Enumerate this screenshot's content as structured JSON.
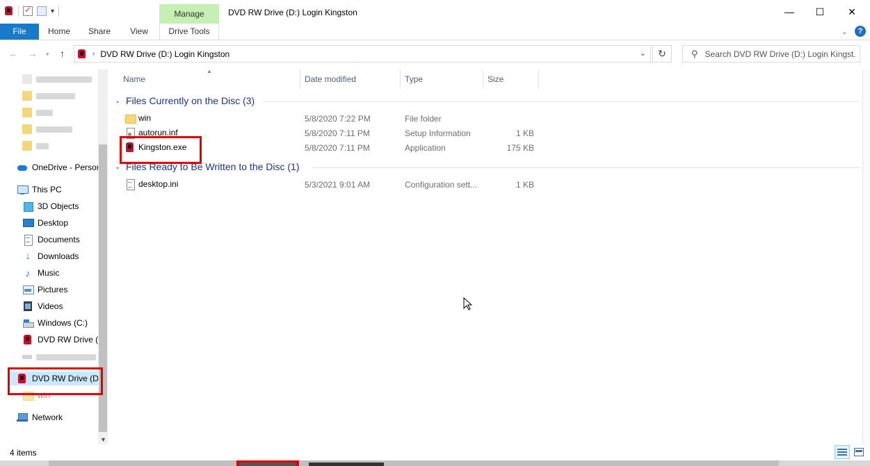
{
  "window": {
    "title": "DVD RW Drive (D:) Login Kingston",
    "manage_tab": "Manage",
    "minimize": "—",
    "maximize": "☐",
    "close": "✕"
  },
  "ribbon": {
    "tabs": [
      "File",
      "Home",
      "Share",
      "View",
      "Drive Tools"
    ],
    "help": "?"
  },
  "address": {
    "path": "DVD RW Drive (D:) Login Kingston",
    "search_placeholder": "Search DVD RW Drive (D:) Login Kingst..."
  },
  "navpane": {
    "items": [
      {
        "label": "OneDrive - Persor",
        "icon": "onedrive-icon"
      },
      {
        "label": "This PC",
        "icon": "pc-icon"
      },
      {
        "label": "3D Objects",
        "icon": "cube-icon"
      },
      {
        "label": "Desktop",
        "icon": "desktop-icon"
      },
      {
        "label": "Documents",
        "icon": "documents-icon"
      },
      {
        "label": "Downloads",
        "icon": "downloads-icon"
      },
      {
        "label": "Music",
        "icon": "music-icon"
      },
      {
        "label": "Pictures",
        "icon": "pictures-icon"
      },
      {
        "label": "Videos",
        "icon": "videos-icon"
      },
      {
        "label": "Windows (C:)",
        "icon": "drive-icon"
      },
      {
        "label": "DVD RW Drive (D",
        "icon": "kingston-icon"
      },
      {
        "label": "DVD RW Drive (D:)",
        "icon": "kingston-icon"
      },
      {
        "label": "win",
        "icon": "folder-icon"
      },
      {
        "label": "Network",
        "icon": "network-icon"
      }
    ]
  },
  "columns": {
    "name": "Name",
    "date": "Date modified",
    "type": "Type",
    "size": "Size"
  },
  "groups": [
    {
      "title": "Files Currently on the Disc (3)",
      "files": [
        {
          "name": "win",
          "date": "5/8/2020 7:22 PM",
          "type": "File folder",
          "size": ""
        },
        {
          "name": "autorun.inf",
          "date": "5/8/2020 7:11 PM",
          "type": "Setup Information",
          "size": "1 KB"
        },
        {
          "name": "Kingston.exe",
          "date": "5/8/2020 7:11 PM",
          "type": "Application",
          "size": "175 KB"
        }
      ]
    },
    {
      "title": "Files Ready to Be Written to the Disc (1)",
      "files": [
        {
          "name": "desktop.ini",
          "date": "5/3/2021 9:01 AM",
          "type": "Configuration sett...",
          "size": "1 KB"
        }
      ]
    }
  ],
  "status": {
    "item_count": "4 items"
  },
  "colors": {
    "file_tab": "#1979ca",
    "manage_tab": "#c6f0b3",
    "group_title": "#1e3287",
    "highlight_box": "#e00000",
    "selection": "#cce8ff"
  }
}
